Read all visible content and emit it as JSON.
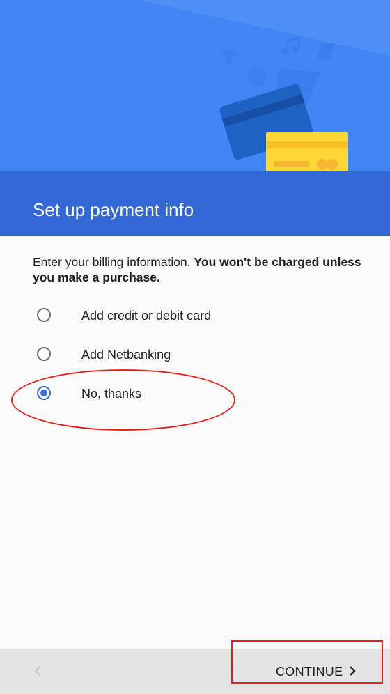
{
  "header": {
    "title": "Set up payment info"
  },
  "main": {
    "billing_intro": "Enter your billing information.",
    "billing_bold": "You won't be charged unless you make a purchase.",
    "options": [
      {
        "label": "Add credit or debit card",
        "selected": false
      },
      {
        "label": "Add Netbanking",
        "selected": false
      },
      {
        "label": "No, thanks",
        "selected": true
      }
    ]
  },
  "footer": {
    "back_icon": "chevron-left-icon",
    "continue_label": "CONTINUE",
    "continue_icon": "chevron-right-icon"
  },
  "colors": {
    "hero_blue": "#4285f4",
    "title_bar_blue": "#3367d6",
    "radio_selected": "#3a6fd8",
    "annotation_red": "#e8201a",
    "card_yellow": "#fdd835",
    "card_blue": "#1e63c4"
  },
  "annotations": {
    "ellipse_around": "No, thanks",
    "rectangle_around": "CONTINUE"
  }
}
